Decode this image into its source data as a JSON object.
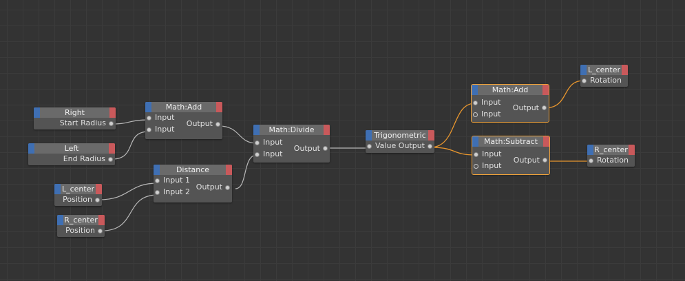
{
  "nodes": {
    "right": {
      "title": "Right",
      "port": "Start Radius"
    },
    "left": {
      "title": "Left",
      "port": "End Radius"
    },
    "lcenter_pos": {
      "title": "L_center",
      "port": "Position"
    },
    "rcenter_pos": {
      "title": "R_center",
      "port": "Position"
    },
    "math_add_1": {
      "title": "Math:Add",
      "in1": "Input",
      "in2": "Input",
      "out": "Output"
    },
    "distance": {
      "title": "Distance",
      "in1": "Input 1",
      "in2": "Input 2",
      "out": "Output"
    },
    "math_divide": {
      "title": "Math:Divide",
      "in1": "Input",
      "in2": "Input",
      "out": "Output"
    },
    "trig": {
      "title": "Trigonometric",
      "in": "Value",
      "out": "Output"
    },
    "math_add_2": {
      "title": "Math:Add",
      "in1": "Input",
      "in2": "Input",
      "out": "Output"
    },
    "math_subtract": {
      "title": "Math:Subtract",
      "in1": "Input",
      "in2": "Input",
      "out": "Output"
    },
    "lcenter_rot": {
      "title": "L_center",
      "port": "Rotation"
    },
    "rcenter_rot": {
      "title": "R_center",
      "port": "Rotation"
    }
  },
  "colors": {
    "wire": "#b8b8b8",
    "wire_selected": "#e8962e",
    "input_tab": "#3f6fb3",
    "output_tab": "#c9595b",
    "selection": "#f0a23a"
  }
}
